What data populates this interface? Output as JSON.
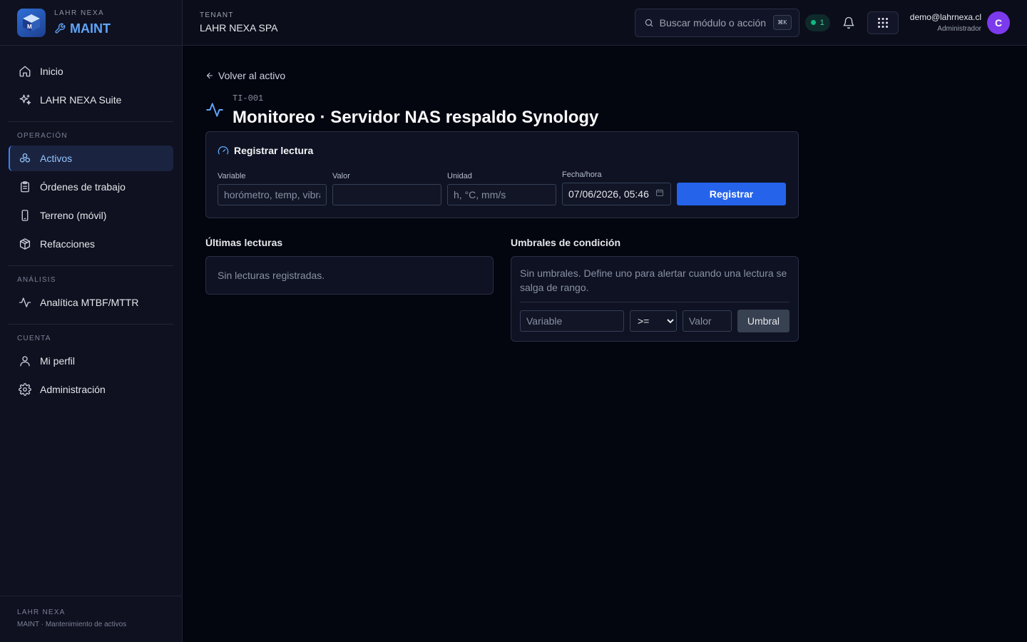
{
  "brand": {
    "top_label": "LAHR NEXA",
    "name": "MAINT",
    "logo_letter": "M"
  },
  "sidebar": {
    "items_top": [
      {
        "label": "Inicio",
        "icon": "home-icon"
      },
      {
        "label": "LAHR NEXA Suite",
        "icon": "sparkles-icon"
      }
    ],
    "sections": [
      {
        "title": "OPERACIÓN",
        "items": [
          {
            "label": "Activos",
            "icon": "assets-icon",
            "active": true
          },
          {
            "label": "Órdenes de trabajo",
            "icon": "clipboard-icon"
          },
          {
            "label": "Terreno (móvil)",
            "icon": "mobile-icon"
          },
          {
            "label": "Refacciones",
            "icon": "package-icon"
          }
        ]
      },
      {
        "title": "ANÁLISIS",
        "items": [
          {
            "label": "Analítica MTBF/MTTR",
            "icon": "activity-icon"
          }
        ]
      },
      {
        "title": "CUENTA",
        "items": [
          {
            "label": "Mi perfil",
            "icon": "user-icon"
          },
          {
            "label": "Administración",
            "icon": "gear-icon"
          }
        ]
      }
    ],
    "footer": {
      "title": "LAHR NEXA",
      "subtitle": "MAINT · Mantenimiento de activos"
    }
  },
  "header": {
    "tenant_label": "TENANT",
    "tenant_name": "LAHR NEXA SPA",
    "search_placeholder": "Buscar módulo o acción",
    "search_shortcut": "⌘K",
    "status_count": "1",
    "user_email": "demo@lahrnexa.cl",
    "user_role": "Administrador",
    "avatar_initial": "C"
  },
  "page": {
    "back_label": "Volver al activo",
    "asset_code": "TI-001",
    "title": "Monitoreo · Servidor NAS respaldo Synology"
  },
  "reading_form": {
    "title": "Registrar lectura",
    "variable_label": "Variable",
    "variable_placeholder": "horómetro, temp, vibración",
    "value_label": "Valor",
    "value_value": "",
    "unit_label": "Unidad",
    "unit_placeholder": "h, °C, mm/s",
    "datetime_label": "Fecha/hora",
    "datetime_value": "07/06/2026, 05:46",
    "submit_label": "Registrar"
  },
  "readings": {
    "title": "Últimas lecturas",
    "empty_text": "Sin lecturas registradas."
  },
  "thresholds": {
    "title": "Umbrales de condición",
    "empty_text": "Sin umbrales. Define uno para alertar cuando una lectura se salga de rango.",
    "variable_placeholder": "Variable",
    "operator_value": ">=",
    "value_placeholder": "Valor",
    "add_label": "Umbral"
  }
}
